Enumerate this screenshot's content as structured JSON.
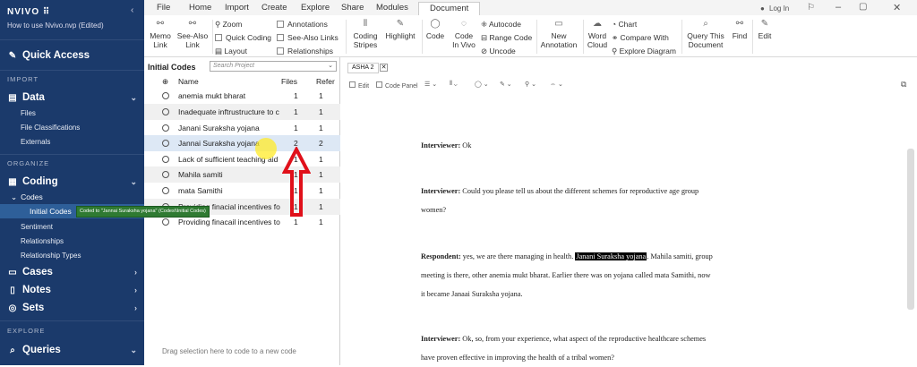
{
  "app": {
    "brand": "NVIVO",
    "brand_mark": "⠿",
    "project": "How to use Nvivo.nvp (Edited)"
  },
  "sidebar": {
    "quick_access": "Quick Access",
    "import_hdr": "IMPORT",
    "data": "Data",
    "files": "Files",
    "file_classifications": "File Classifications",
    "externals": "Externals",
    "organize_hdr": "ORGANIZE",
    "coding": "Coding",
    "codes": "Codes",
    "initial_codes": "Initial Codes",
    "sentiment": "Sentiment",
    "relationships": "Relationships",
    "relationship_types": "Relationship Types",
    "cases": "Cases",
    "notes": "Notes",
    "sets": "Sets",
    "explore_hdr": "EXPLORE",
    "queries": "Queries"
  },
  "ribbon": {
    "tabs": [
      "File",
      "Home",
      "Import",
      "Create",
      "Explore",
      "Share",
      "Modules",
      "Document"
    ],
    "login": "Log In",
    "memo_link": [
      "Memo",
      "Link"
    ],
    "see_also_link": [
      "See-Also",
      "Link"
    ],
    "zoom": "Zoom",
    "quick_coding": "Quick Coding",
    "layout": "Layout",
    "annotations": "Annotations",
    "see_also_links": "See-Also Links",
    "relationships": "Relationships",
    "coding_stripes": [
      "Coding",
      "Stripes"
    ],
    "highlight": "Highlight",
    "code": "Code",
    "code_in_vivo": [
      "Code",
      "In Vivo"
    ],
    "autocode": "Autocode",
    "range_code": "Range Code",
    "uncode": "Uncode",
    "new_annotation": [
      "New",
      "Annotation"
    ],
    "word_cloud": [
      "Word",
      "Cloud"
    ],
    "chart": "Chart",
    "compare_with": "Compare With",
    "explore_diagram": "Explore Diagram",
    "query_this_doc": [
      "Query This",
      "Document"
    ],
    "find": "Find",
    "edit": "Edit"
  },
  "codes_pane": {
    "title": "Initial Codes",
    "search_placeholder": "Search Project",
    "col_name": "Name",
    "col_files": "Files",
    "col_refs": "Refer",
    "rows": [
      {
        "name": "anemia mukt bharat",
        "files": "1",
        "refs": "1"
      },
      {
        "name": "Inadequate inftrustructure to c",
        "files": "1",
        "refs": "1"
      },
      {
        "name": "Janani Suraksha yojana",
        "files": "1",
        "refs": "1"
      },
      {
        "name": "Jannai Suraksha yojana",
        "files": "2",
        "refs": "2"
      },
      {
        "name": "Lack of sufficient  teaching aid",
        "files": "1",
        "refs": "1"
      },
      {
        "name": "Mahila samiti",
        "files": "1",
        "refs": "1"
      },
      {
        "name": "mata Samithi",
        "files": "1",
        "refs": "1"
      },
      {
        "name": "Providing  finacial incentives fo",
        "files": "1",
        "refs": "1"
      },
      {
        "name": "Providing finacail incentives to",
        "files": "1",
        "refs": "1"
      }
    ],
    "drag_hint": "Drag selection here to code to a new code",
    "tooltip": "Coded to \"Jannai Suraksha yojana\" (Codes\\\\Initial Codes)"
  },
  "document": {
    "tab": "ASHA 2",
    "tool_edit": "Edit",
    "tool_code_panel": "Code Panel",
    "p1_speaker": "Interviewer:",
    "p1_text": " Ok",
    "p2_speaker": "Interviewer:",
    "p2_text": " Could you please tell us about the different schemes for reproductive age group women?",
    "p3_speaker": "Respondent:",
    "p3_pre": " yes, we are there managing in health. ",
    "p3_hi": "Janani Suraksha yojana",
    "p3_post": ". Mahila samiti, group meeting is there, other anemia mukt bharat. Earlier there was on yojana called mata Samithi, now it became Janaai Suraksha yojana.",
    "p4_speaker": "Interviewer:",
    "p4_text": " Ok, so, from your experience, what aspect of the reproductive healthcare schemes have proven effective in improving the health of a tribal women?"
  },
  "colors": {
    "sidebar": "#1b3a6b",
    "selected": "#2e5f99",
    "highlight_row": "#dde8f5",
    "arrow": "#e0101a",
    "tooltip": "#2f7a32"
  }
}
